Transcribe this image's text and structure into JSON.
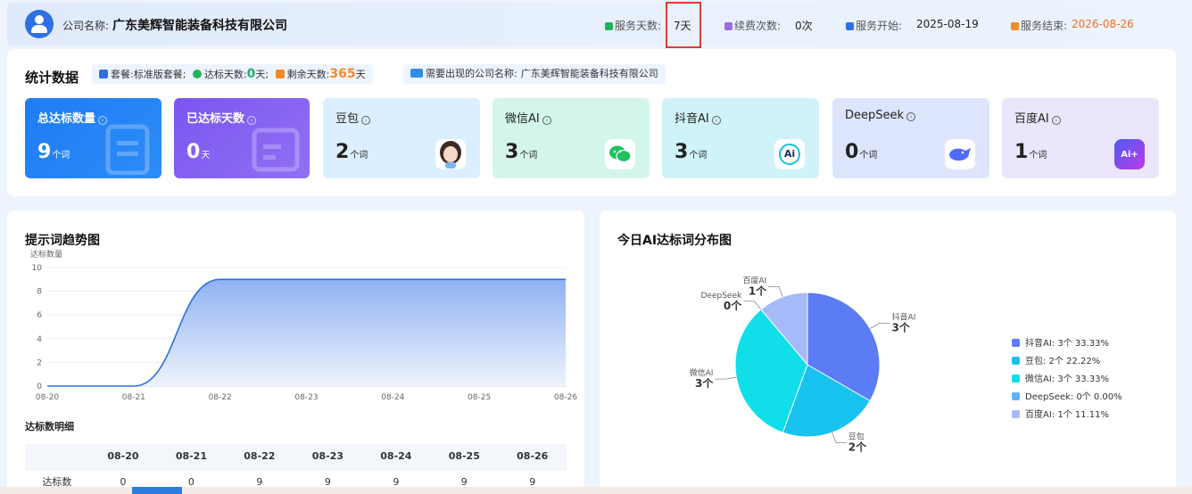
{
  "header": {
    "company_label": "公司名称:",
    "company_name": "广东美辉智能装备科技有限公司",
    "service_days_label": "服务天数:",
    "service_days_value": "7天",
    "renew_label": "续费次数:",
    "renew_value": "0次",
    "start_label": "服务开始:",
    "start_value": "2025-08-19",
    "end_label": "服务结束:",
    "end_value": "2026-08-26"
  },
  "stats": {
    "title": "统计数据",
    "package_label": "套餐:",
    "package_value": "标准版套餐;",
    "reached_label": "达标天数:",
    "reached_value": "0",
    "reached_unit": "天;",
    "remaining_label": "剩余天数:",
    "remaining_value": "365",
    "remaining_unit": "天",
    "company_need_label": "需要出现的公司名称:",
    "company_need_value": "广东美辉智能装备科技有限公司",
    "tiles": [
      {
        "title": "总达标数量",
        "value": "9",
        "unit": "个词"
      },
      {
        "title": "已达标天数",
        "value": "0",
        "unit": "天"
      },
      {
        "title": "豆包",
        "value": "2",
        "unit": "个词"
      },
      {
        "title": "微信AI",
        "value": "3",
        "unit": "个词"
      },
      {
        "title": "抖音AI",
        "value": "3",
        "unit": "个词"
      },
      {
        "title": "DeepSeek",
        "value": "0",
        "unit": "个词"
      },
      {
        "title": "百度AI",
        "value": "1",
        "unit": "个词"
      }
    ],
    "icon_text_douyin": "Ai",
    "icon_text_baidu": "Ai+"
  },
  "trend": {
    "title": "提示词趋势图",
    "detail_title": "达标数明细",
    "row_label": "达标数",
    "colors": {
      "line": "#2f6fe4",
      "area_top": "#8fb2f2",
      "area_bottom": "#eef3fd"
    }
  },
  "pie": {
    "title": "今日AI达标词分布图",
    "unit": "个"
  },
  "chart_data": [
    {
      "type": "area",
      "title": "提示词趋势图",
      "ylabel": "达标数量",
      "xlabel": "",
      "x": [
        "08-20",
        "08-21",
        "08-22",
        "08-23",
        "08-24",
        "08-25",
        "08-26"
      ],
      "series": [
        {
          "values": [
            0,
            0,
            9,
            9,
            9,
            9,
            9
          ]
        }
      ],
      "ylim": [
        0,
        10
      ],
      "yticks": [
        0,
        2,
        4,
        6,
        8,
        10
      ],
      "grid": true
    },
    {
      "type": "pie",
      "title": "今日AI达标词分布图",
      "slices": [
        {
          "label": "抖音AI",
          "value": 3,
          "percent": "33.33%",
          "color": "#5b7cf5",
          "value_label": "3个"
        },
        {
          "label": "豆包",
          "value": 2,
          "percent": "22.22%",
          "color": "#19c3f0",
          "value_label": "2个"
        },
        {
          "label": "微信AI",
          "value": 3,
          "percent": "33.33%",
          "color": "#10dfe9",
          "value_label": "3个"
        },
        {
          "label": "DeepSeek",
          "value": 0,
          "percent": "0.00%",
          "color": "#62b3f4",
          "value_label": "0个"
        },
        {
          "label": "百度AI",
          "value": 1,
          "percent": "11.11%",
          "color": "#a6b9f8",
          "value_label": "1个"
        }
      ],
      "legend": [
        "抖音AI: 3个 33.33%",
        "豆包: 2个 22.22%",
        "微信AI: 3个 33.33%",
        "DeepSeek: 0个 0.00%",
        "百度AI: 1个 11.11%"
      ],
      "legend_position": "right"
    }
  ]
}
